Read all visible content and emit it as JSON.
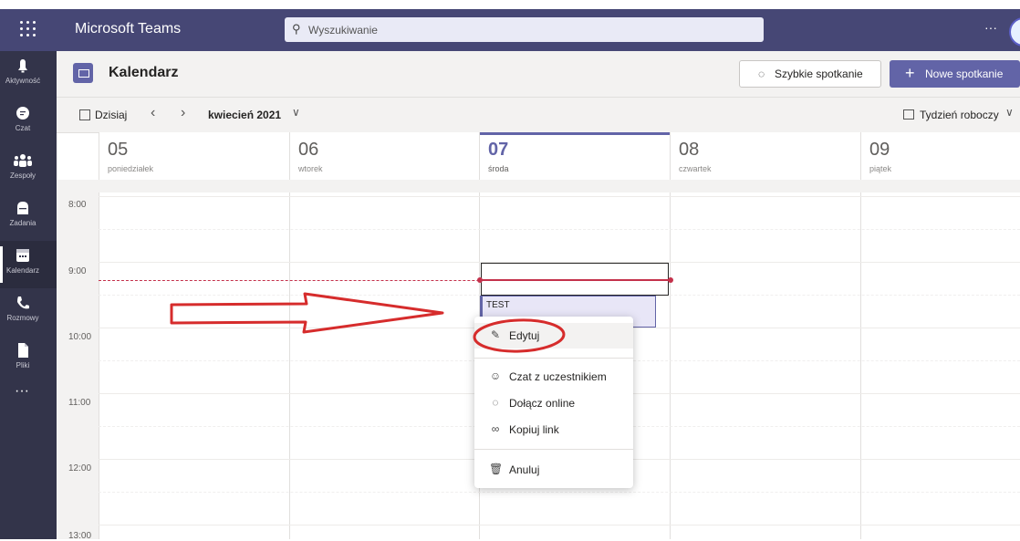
{
  "app": {
    "name": "Microsoft Teams"
  },
  "search": {
    "placeholder": "Wyszukiwanie"
  },
  "top_more": "···",
  "rail": {
    "items": [
      {
        "label": "Aktywność",
        "icon": "bell-icon"
      },
      {
        "label": "Czat",
        "icon": "chat-icon"
      },
      {
        "label": "Zespoły",
        "icon": "teams-icon"
      },
      {
        "label": "Zadania",
        "icon": "tasks-icon"
      },
      {
        "label": "Kalendarz",
        "icon": "calendar-icon",
        "active": true
      },
      {
        "label": "Rozmowy",
        "icon": "phone-icon"
      },
      {
        "label": "Pliki",
        "icon": "file-icon"
      }
    ],
    "more": "···"
  },
  "header": {
    "title": "Kalendarz",
    "meet_now": "Szybkie spotkanie",
    "new_meeting": "Nowe spotkanie"
  },
  "nav": {
    "today": "Dzisiaj",
    "month": "kwiecień 2021",
    "view": "Tydzień roboczy"
  },
  "days": [
    {
      "num": "05",
      "name": "poniedziałek"
    },
    {
      "num": "06",
      "name": "wtorek"
    },
    {
      "num": "07",
      "name": "środa",
      "today": true
    },
    {
      "num": "08",
      "name": "czwartek"
    },
    {
      "num": "09",
      "name": "piątek"
    }
  ],
  "times": [
    "8:00",
    "9:00",
    "10:00",
    "11:00",
    "12:00",
    "13:00"
  ],
  "event": {
    "title": "TEST"
  },
  "menu": {
    "edit": "Edytuj",
    "chat": "Czat z uczestnikiem",
    "join": "Dołącz online",
    "copy": "Kopiuj link",
    "cancel": "Anuluj"
  },
  "colors": {
    "titlebar": "#464775",
    "rail": "#33344a",
    "accent": "#6264a7",
    "annotation": "#d62c2c"
  }
}
